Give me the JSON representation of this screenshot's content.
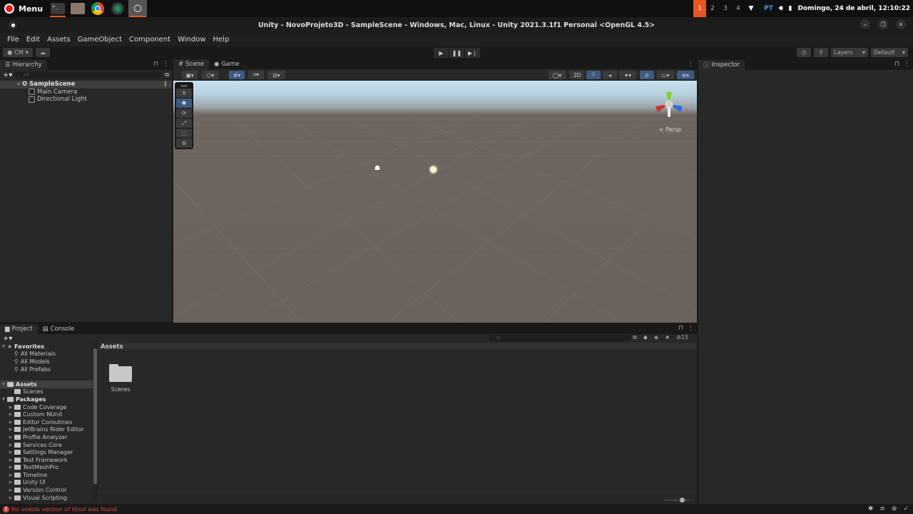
{
  "taskbar": {
    "menu_label": "Menu",
    "apps": [
      "terminal-icon",
      "files-icon",
      "chrome-icon",
      "camera-icon",
      "unity-icon"
    ],
    "workspaces": [
      "1",
      "2",
      "3",
      "4"
    ],
    "active_workspace": "1",
    "language": "PT",
    "datetime": "Domingo, 24 de abril, 12:10:22"
  },
  "window": {
    "title": "Unity - NovoProjeto3D - SampleScene - Windows, Mac, Linux - Unity 2021.3.1f1 Personal <OpenGL 4.5>",
    "minimize": "–",
    "maximize": "❐",
    "close": "✕"
  },
  "menubar": [
    "File",
    "Edit",
    "Assets",
    "GameObject",
    "Component",
    "Window",
    "Help"
  ],
  "toolbar": {
    "account": "CM",
    "layers": "Layers",
    "layout": "Default",
    "play": "▶",
    "pause": "❚❚",
    "step": "▶❘"
  },
  "hierarchy": {
    "tab": "Hierarchy",
    "search_placeholder": "All",
    "scene": "SampleScene",
    "objects": [
      "Main Camera",
      "Directional Light"
    ]
  },
  "sceneview": {
    "tabs": [
      "Scene",
      "Game"
    ],
    "mode_2d": "2D",
    "persp": "Persp",
    "tools": [
      "hand",
      "move",
      "rotate",
      "scale",
      "rect",
      "transform"
    ],
    "active_tool": "move"
  },
  "inspector": {
    "tab": "Inspector"
  },
  "project": {
    "tabs": [
      "Project",
      "Console"
    ],
    "favorites": {
      "label": "Favorites",
      "items": [
        "All Materials",
        "All Models",
        "All Prefabs"
      ]
    },
    "assets": {
      "label": "Assets",
      "items": [
        "Scenes"
      ]
    },
    "packages": {
      "label": "Packages",
      "items": [
        "Code Coverage",
        "Custom NUnit",
        "Editor Coroutines",
        "JetBrains Rider Editor",
        "Profile Analyzer",
        "Services Core",
        "Settings Manager",
        "Test Framework",
        "TextMeshPro",
        "Timeline",
        "Unity UI",
        "Version Control",
        "Visual Scripting"
      ]
    },
    "breadcrumb": "Assets",
    "grid_items": [
      "Scenes"
    ],
    "hidden_count": "15",
    "zoom_slider": 0.7
  },
  "status": {
    "error": "No usable version of libssl was found"
  }
}
